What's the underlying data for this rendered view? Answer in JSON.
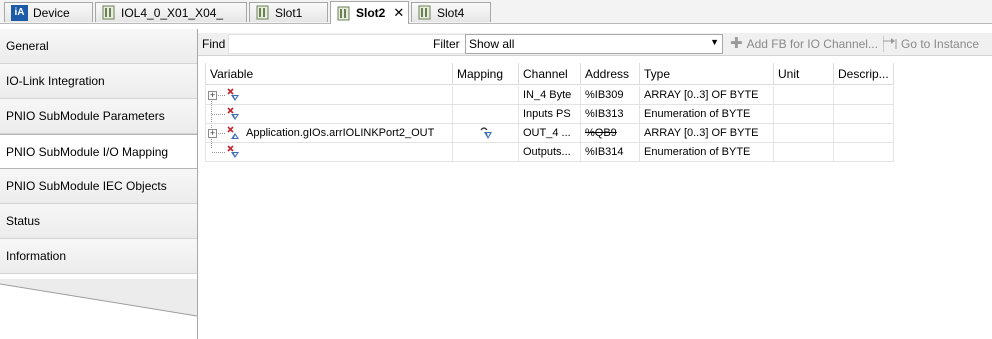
{
  "tabs": [
    {
      "label": "Device",
      "icon": "ia-icon",
      "active": false,
      "closable": false
    },
    {
      "label": "IOL4_0_X01_X04_",
      "icon": "module-icon",
      "active": false,
      "closable": false
    },
    {
      "label": "Slot1",
      "icon": "module-icon",
      "active": false,
      "closable": false
    },
    {
      "label": "Slot2",
      "icon": "module-icon",
      "active": true,
      "closable": true
    },
    {
      "label": "Slot4",
      "icon": "module-icon",
      "active": false,
      "closable": false
    }
  ],
  "device_tab_badge": "iA",
  "close_glyph": "✕",
  "sidebar": {
    "items": [
      {
        "label": "General"
      },
      {
        "label": "IO-Link Integration"
      },
      {
        "label": "PNIO SubModule Parameters"
      },
      {
        "label": "PNIO SubModule I/O Mapping",
        "active": true
      },
      {
        "label": "PNIO SubModule IEC Objects"
      },
      {
        "label": "Status"
      },
      {
        "label": "Information"
      }
    ]
  },
  "toolbar": {
    "find_label": "Find",
    "find_value": "",
    "filter_label": "Filter",
    "filter_value": "Show all",
    "add_fb_label": "Add FB for IO Channel...",
    "goto_label": "Go to Instance"
  },
  "grid": {
    "columns": [
      "Variable",
      "Mapping",
      "Channel",
      "Address",
      "Type",
      "Unit",
      "Descrip..."
    ],
    "rows": [
      {
        "variable": "",
        "mapping": "",
        "channel": "IN_4 Byte",
        "address": "%IB309",
        "address_strike": false,
        "type": "ARRAY [0..3] OF BYTE",
        "unit": "",
        "description": "",
        "expandable": true,
        "mapped": false
      },
      {
        "variable": "",
        "mapping": "",
        "channel": "Inputs PS",
        "address": "%IB313",
        "address_strike": false,
        "type": "Enumeration of BYTE",
        "unit": "",
        "description": "",
        "expandable": false,
        "mapped": false
      },
      {
        "variable": "Application.gIOs.arrIOLINKPort2_OUT",
        "mapping": "existing-variable-icon",
        "channel": "OUT_4 ...",
        "address": "%QB9",
        "address_strike": true,
        "type": "ARRAY [0..3] OF BYTE",
        "unit": "",
        "description": "",
        "expandable": true,
        "mapped": true
      },
      {
        "variable": "",
        "mapping": "",
        "channel": "Outputs...",
        "address": "%IB314",
        "address_strike": false,
        "type": "Enumeration of BYTE",
        "unit": "",
        "description": "",
        "expandable": false,
        "mapped": false
      }
    ]
  },
  "colors": {
    "ia_badge": "#1d5aa8",
    "var_icon_blue": "#3d6fb6",
    "var_icon_red": "#c4262e"
  }
}
